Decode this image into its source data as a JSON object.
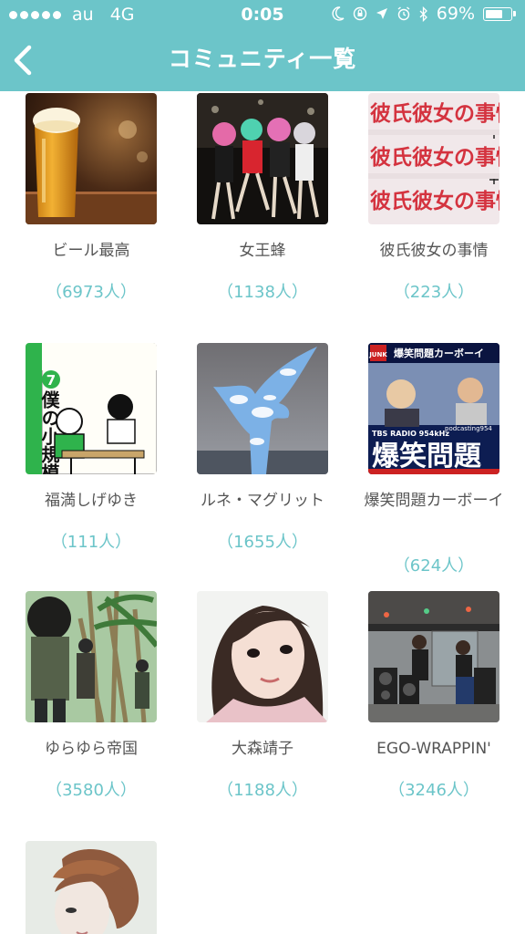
{
  "status_bar": {
    "carrier": "au",
    "network": "4G",
    "time": "0:05",
    "battery": "69%",
    "battery_level": 0.69
  },
  "nav": {
    "title": "コミュニティ一覧"
  },
  "communities": [
    {
      "name": "ビール最高",
      "count": "（6973人）"
    },
    {
      "name": "女王蜂",
      "count": "（1138人）"
    },
    {
      "name": "彼氏彼女の事情",
      "count": "（223人）"
    },
    {
      "name": "福満しげゆき",
      "count": "（111人）"
    },
    {
      "name": "ルネ・マグリット",
      "count": "（1655人）"
    },
    {
      "name": "爆笑問題カーボーイ",
      "count": "（624人）"
    },
    {
      "name": "ゆらゆら帝国",
      "count": "（3580人）"
    },
    {
      "name": "大森靖子",
      "count": "（1188人）"
    },
    {
      "name": "EGO-WRAPPIN'",
      "count": "（3246人）"
    },
    {
      "name": "",
      "count": ""
    }
  ],
  "thumbnail_text": {
    "kareshi": "彼氏彼女の事情",
    "fukumitsu_title": "僕の小規模な生活",
    "fukumitsu_volume": "7",
    "bakusho_header": "爆笑問題カーボーイ",
    "bakusho_station": "TBS RADIO 954kHz",
    "bakusho_podcast": "podcasting954",
    "bakusho_big": "爆笑問題",
    "bakusho_logo": "JUNK"
  }
}
